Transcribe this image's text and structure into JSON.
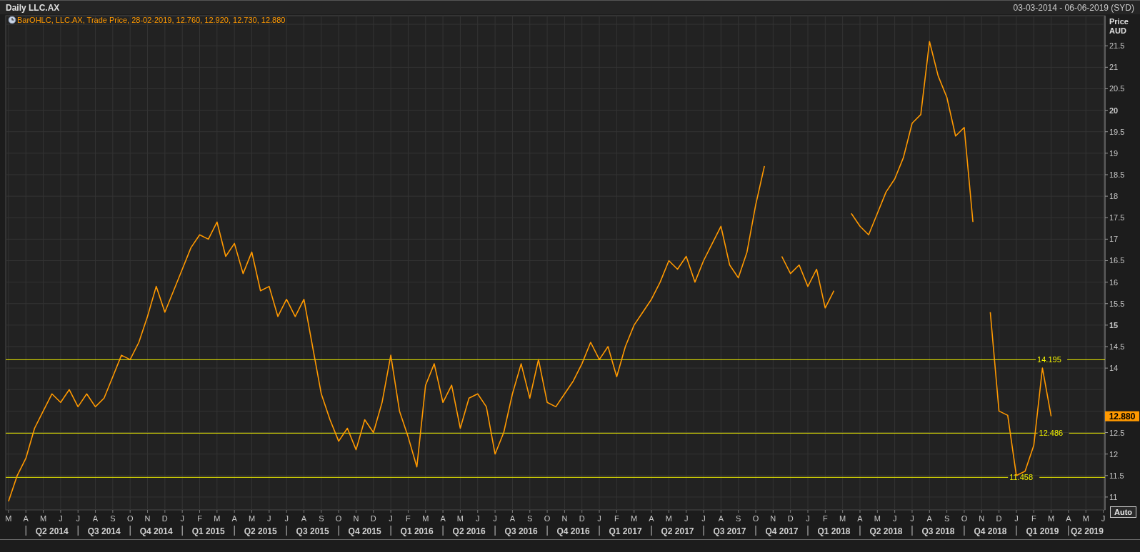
{
  "window": {
    "title": "Daily LLC.AX",
    "date_range": "03-03-2014 - 06-06-2019 (SYD)"
  },
  "legend": {
    "text": "BarOHLC, LLC.AX, Trade Price, 28-02-2019, 12.760, 12.920, 12.730, 12.880"
  },
  "axis_title": {
    "line_1": "Price",
    "line_2": "AUD"
  },
  "last_price": {
    "label": "12.880"
  },
  "auto_button": {
    "label": "Auto"
  },
  "quarters": [
    "Q2 2014",
    "Q3 2014",
    "Q4 2014",
    "Q1 2015",
    "Q2 2015",
    "Q3 2015",
    "Q4 2015",
    "Q1 2016",
    "Q2 2016",
    "Q3 2016",
    "Q4 2016",
    "Q1 2017",
    "Q2 2017",
    "Q3 2017",
    "Q4 2017",
    "Q1 2018",
    "Q2 2018",
    "Q3 2018",
    "Q4 2018",
    "Q1 2019",
    "Q2 2019"
  ],
  "chart_data": {
    "type": "line",
    "grid": true,
    "ylim": [
      10.7,
      22.2
    ],
    "categories": [
      "M",
      null,
      "A",
      null,
      "M",
      null,
      "J",
      null,
      "J",
      null,
      "A",
      null,
      "S",
      null,
      "O",
      null,
      "N",
      null,
      "D",
      null,
      "J",
      null,
      "F",
      null,
      "M",
      null,
      "A",
      null,
      "M",
      null,
      "J",
      null,
      "J",
      null,
      "A",
      null,
      "S",
      null,
      "O",
      null,
      "N",
      null,
      "D",
      null,
      "J",
      null,
      "F",
      null,
      "M",
      null,
      "A",
      null,
      "M",
      null,
      "J",
      null,
      "J",
      null,
      "A",
      null,
      "S",
      null,
      "O",
      null,
      "N",
      null,
      "D",
      null,
      "J",
      null,
      "F",
      null,
      "M",
      null,
      "A",
      null,
      "M",
      null,
      "J",
      null,
      "J",
      null,
      "A",
      null,
      "S",
      null,
      "O",
      null,
      "N",
      null,
      "D",
      null,
      "J",
      null,
      "F",
      null,
      "M",
      null,
      "A",
      null,
      "M",
      null,
      "J",
      null,
      "J",
      null,
      "A",
      null,
      "S",
      null,
      "O",
      null,
      "N",
      null,
      "D",
      null,
      "J",
      null,
      "F",
      null,
      "M",
      null,
      "A",
      null,
      "M",
      null,
      "J"
    ],
    "series": [
      {
        "color": "#ff9900",
        "values": [
          10.9,
          11.5,
          11.9,
          12.6,
          13.0,
          13.4,
          13.2,
          13.5,
          13.1,
          13.4,
          13.1,
          13.3,
          13.8,
          14.3,
          14.2,
          14.6,
          15.2,
          15.9,
          15.3,
          15.8,
          16.3,
          16.8,
          17.1,
          17.0,
          17.4,
          16.6,
          16.9,
          16.2,
          16.7,
          15.8,
          15.9,
          15.2,
          15.6,
          15.2,
          15.6,
          14.5,
          13.4,
          12.8,
          12.3,
          12.6,
          12.1,
          12.8,
          12.5,
          13.2,
          14.3,
          13.0,
          12.4,
          11.7,
          13.6,
          14.1,
          13.2,
          13.6,
          12.6,
          13.3,
          13.4,
          13.1,
          12.0,
          12.5,
          13.4,
          14.1,
          13.3,
          14.2,
          13.2,
          13.1,
          13.4,
          13.7,
          14.1,
          14.6,
          14.2,
          14.5,
          13.8,
          14.5,
          15.0,
          15.3,
          15.6,
          16.0,
          16.5,
          16.3,
          16.6,
          16.0,
          16.5,
          16.9,
          17.3,
          16.4,
          16.1,
          16.7,
          17.8,
          18.7,
          null,
          16.6,
          16.2,
          16.4,
          15.9,
          16.3,
          15.4,
          15.8,
          null,
          17.6,
          17.3,
          17.1,
          17.6,
          18.1,
          18.4,
          18.9,
          19.7,
          19.9,
          21.6,
          20.8,
          20.3,
          19.4,
          19.6,
          17.4,
          null,
          15.3,
          13.0,
          12.9,
          11.5,
          11.6,
          12.2,
          14.0,
          12.88,
          null,
          null,
          null,
          null,
          null,
          null
        ]
      }
    ],
    "yticks": [
      11,
      11.5,
      12,
      12.5,
      14,
      14.5,
      15,
      15.5,
      16,
      16.5,
      17,
      17.5,
      18,
      18.5,
      19,
      19.5,
      20,
      20.5,
      21,
      21.5
    ],
    "ref_lines": [
      {
        "label": "14.195"
      },
      {
        "label": "12.486"
      },
      {
        "label": "11.458"
      }
    ]
  }
}
